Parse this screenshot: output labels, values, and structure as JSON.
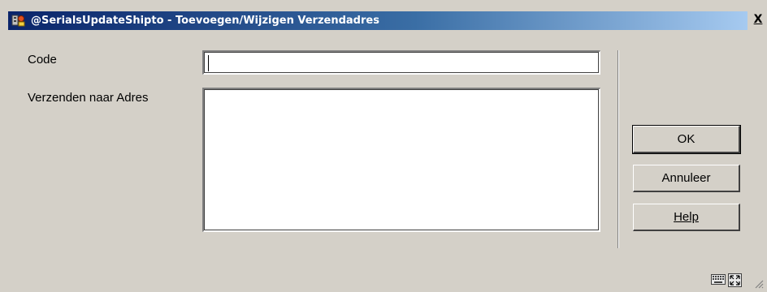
{
  "window": {
    "title": "@SerialsUpdateShipto - Toevoegen/Wijzigen Verzendadres",
    "close_label": "X"
  },
  "form": {
    "code_label": "Code",
    "code_value": "",
    "address_label": "Verzenden naar Adres",
    "address_value": ""
  },
  "buttons": {
    "ok_label": "OK",
    "cancel_label": "Annuleer",
    "help_label": "Help"
  },
  "colors": {
    "titlebar_start": "#0a246a",
    "titlebar_end": "#a6caf0",
    "dialog_bg": "#d4d0c8"
  },
  "icons": {
    "app": "app-icon",
    "close": "close-icon",
    "keyboard": "keyboard-icon",
    "expand": "expand-icon",
    "grip": "resize-grip-icon"
  }
}
